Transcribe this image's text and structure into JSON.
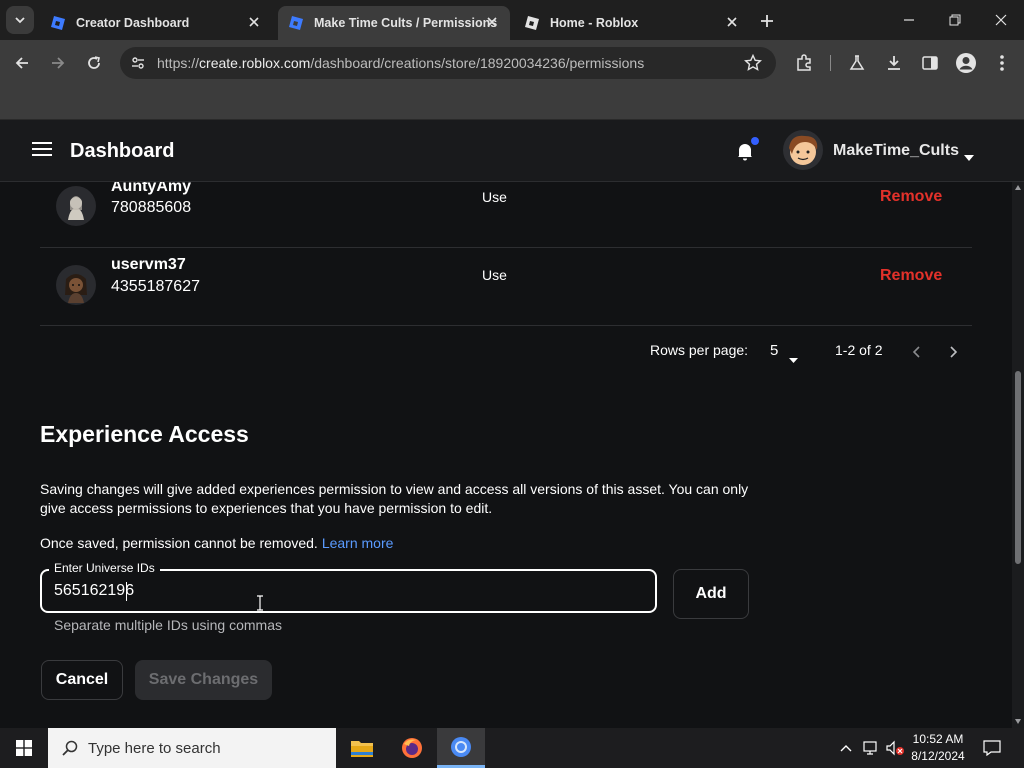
{
  "browser": {
    "tabs": [
      {
        "title": "Creator Dashboard",
        "active": false
      },
      {
        "title": "Make Time Cults / Permissions",
        "active": true
      },
      {
        "title": "Home - Roblox",
        "active": false
      }
    ],
    "url_prefix": "https://",
    "url_host": "create.roblox.com",
    "url_path": "/dashboard/creations/store/18920034236/permissions"
  },
  "header": {
    "title": "Dashboard",
    "username": "MakeTime_Cults"
  },
  "permissions_table": {
    "rows": [
      {
        "name": "AuntyAmy",
        "id": "780885608",
        "permission": "Use",
        "action": "Remove"
      },
      {
        "name": "uservm37",
        "id": "4355187627",
        "permission": "Use",
        "action": "Remove"
      }
    ],
    "pagination": {
      "rows_per_page_label": "Rows per page:",
      "rows_per_page_value": "5",
      "range": "1-2 of 2"
    }
  },
  "experience_access": {
    "title": "Experience Access",
    "description": "Saving changes will give added experiences permission to view and access all versions of this asset. You can only give access permissions to experiences that you have permission to edit.",
    "notice": "Once saved, permission cannot be removed.",
    "learn_more": "Learn more",
    "input_label": "Enter Universe IDs",
    "input_value": "565162196",
    "helper": "Separate multiple IDs using commas",
    "add_label": "Add",
    "cancel_label": "Cancel",
    "save_label": "Save Changes"
  },
  "taskbar": {
    "search_placeholder": "Type here to search",
    "time": "10:52 AM",
    "date": "8/12/2024"
  },
  "colors": {
    "remove": "#e3312a",
    "link": "#5a9bff",
    "notification": "#335fff",
    "background": "#111214"
  }
}
